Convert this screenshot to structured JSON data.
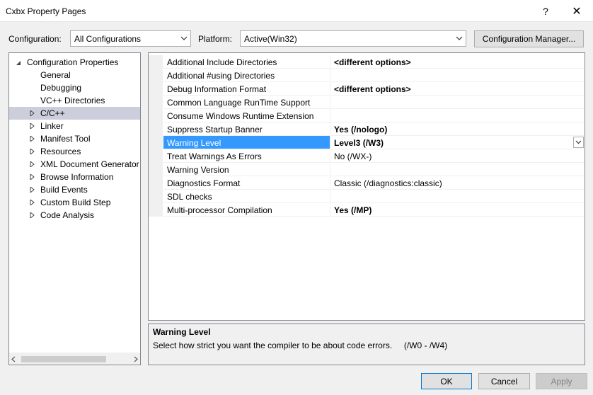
{
  "window": {
    "title": "Cxbx Property Pages",
    "help_glyph": "?",
    "close_glyph": "✕"
  },
  "toolbar": {
    "configuration_label": "Configuration:",
    "configuration_value": "All Configurations",
    "platform_label": "Platform:",
    "platform_value": "Active(Win32)",
    "config_manager_label": "Configuration Manager..."
  },
  "tree": {
    "root": {
      "label": "Configuration Properties",
      "expanded": true
    },
    "items": [
      {
        "label": "General",
        "expandable": false,
        "selected": false
      },
      {
        "label": "Debugging",
        "expandable": false,
        "selected": false
      },
      {
        "label": "VC++ Directories",
        "expandable": false,
        "selected": false
      },
      {
        "label": "C/C++",
        "expandable": true,
        "selected": true
      },
      {
        "label": "Linker",
        "expandable": true,
        "selected": false
      },
      {
        "label": "Manifest Tool",
        "expandable": true,
        "selected": false
      },
      {
        "label": "Resources",
        "expandable": true,
        "selected": false
      },
      {
        "label": "XML Document Generator",
        "expandable": true,
        "selected": false
      },
      {
        "label": "Browse Information",
        "expandable": true,
        "selected": false
      },
      {
        "label": "Build Events",
        "expandable": true,
        "selected": false
      },
      {
        "label": "Custom Build Step",
        "expandable": true,
        "selected": false
      },
      {
        "label": "Code Analysis",
        "expandable": true,
        "selected": false
      }
    ]
  },
  "properties": [
    {
      "name": "Additional Include Directories",
      "value": "<different options>",
      "bold": true
    },
    {
      "name": "Additional #using Directories",
      "value": "",
      "bold": false
    },
    {
      "name": "Debug Information Format",
      "value": "<different options>",
      "bold": true
    },
    {
      "name": "Common Language RunTime Support",
      "value": "",
      "bold": false
    },
    {
      "name": "Consume Windows Runtime Extension",
      "value": "",
      "bold": false
    },
    {
      "name": "Suppress Startup Banner",
      "value": "Yes (/nologo)",
      "bold": true
    },
    {
      "name": "Warning Level",
      "value": "Level3 (/W3)",
      "bold": true,
      "selected": true
    },
    {
      "name": "Treat Warnings As Errors",
      "value": "No (/WX-)",
      "bold": false
    },
    {
      "name": "Warning Version",
      "value": "",
      "bold": false
    },
    {
      "name": "Diagnostics Format",
      "value": "Classic (/diagnostics:classic)",
      "bold": false
    },
    {
      "name": "SDL checks",
      "value": "",
      "bold": false
    },
    {
      "name": "Multi-processor Compilation",
      "value": "Yes (/MP)",
      "bold": true
    }
  ],
  "description": {
    "title": "Warning Level",
    "text": "Select how strict you want the compiler to be about code errors.     (/W0 - /W4)"
  },
  "buttons": {
    "ok": "OK",
    "cancel": "Cancel",
    "apply": "Apply"
  },
  "colors": {
    "selection": "#3399ff",
    "tree_selection": "#cccedb",
    "border": "#828790"
  }
}
